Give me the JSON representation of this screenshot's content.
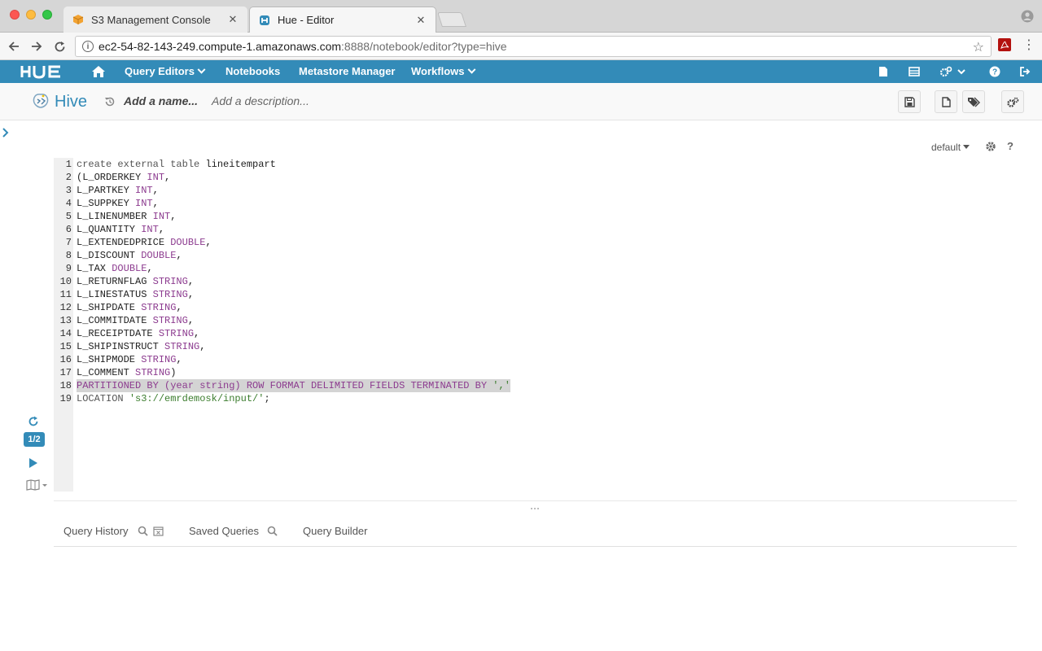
{
  "browser": {
    "tabs": [
      {
        "title": "S3 Management Console",
        "close": "✕"
      },
      {
        "title": "Hue - Editor",
        "close": "✕"
      }
    ],
    "url_host": "ec2-54-82-143-249.compute-1.amazonaws.com",
    "url_rest": ":8888/notebook/editor?type=hive"
  },
  "nav": {
    "brand": "HUE",
    "items": [
      "Query Editors",
      "Notebooks",
      "Metastore Manager",
      "Workflows"
    ]
  },
  "editor": {
    "title": "Hive",
    "name_placeholder": "Add a name...",
    "description_placeholder": "Add a description..."
  },
  "snippet": {
    "database": "default",
    "help": "?",
    "statement_badge": "1/2"
  },
  "code_lines": [
    "create external table lineitempart",
    "(L_ORDERKEY INT,",
    "L_PARTKEY INT,",
    "L_SUPPKEY INT,",
    "L_LINENUMBER INT,",
    "L_QUANTITY INT,",
    "L_EXTENDEDPRICE DOUBLE,",
    "L_DISCOUNT DOUBLE,",
    "L_TAX DOUBLE,",
    "L_RETURNFLAG STRING,",
    "L_LINESTATUS STRING,",
    "L_SHIPDATE STRING,",
    "L_COMMITDATE STRING,",
    "L_RECEIPTDATE STRING,",
    "L_SHIPINSTRUCT STRING,",
    "L_SHIPMODE STRING,",
    "L_COMMENT STRING)",
    "PARTITIONED BY (year string) ROW FORMAT DELIMITED FIELDS TERMINATED BY ','",
    "LOCATION 's3://emrdemosk/input/';"
  ],
  "bottom_tabs": {
    "history": "Query History",
    "saved": "Saved Queries",
    "builder": "Query Builder"
  }
}
